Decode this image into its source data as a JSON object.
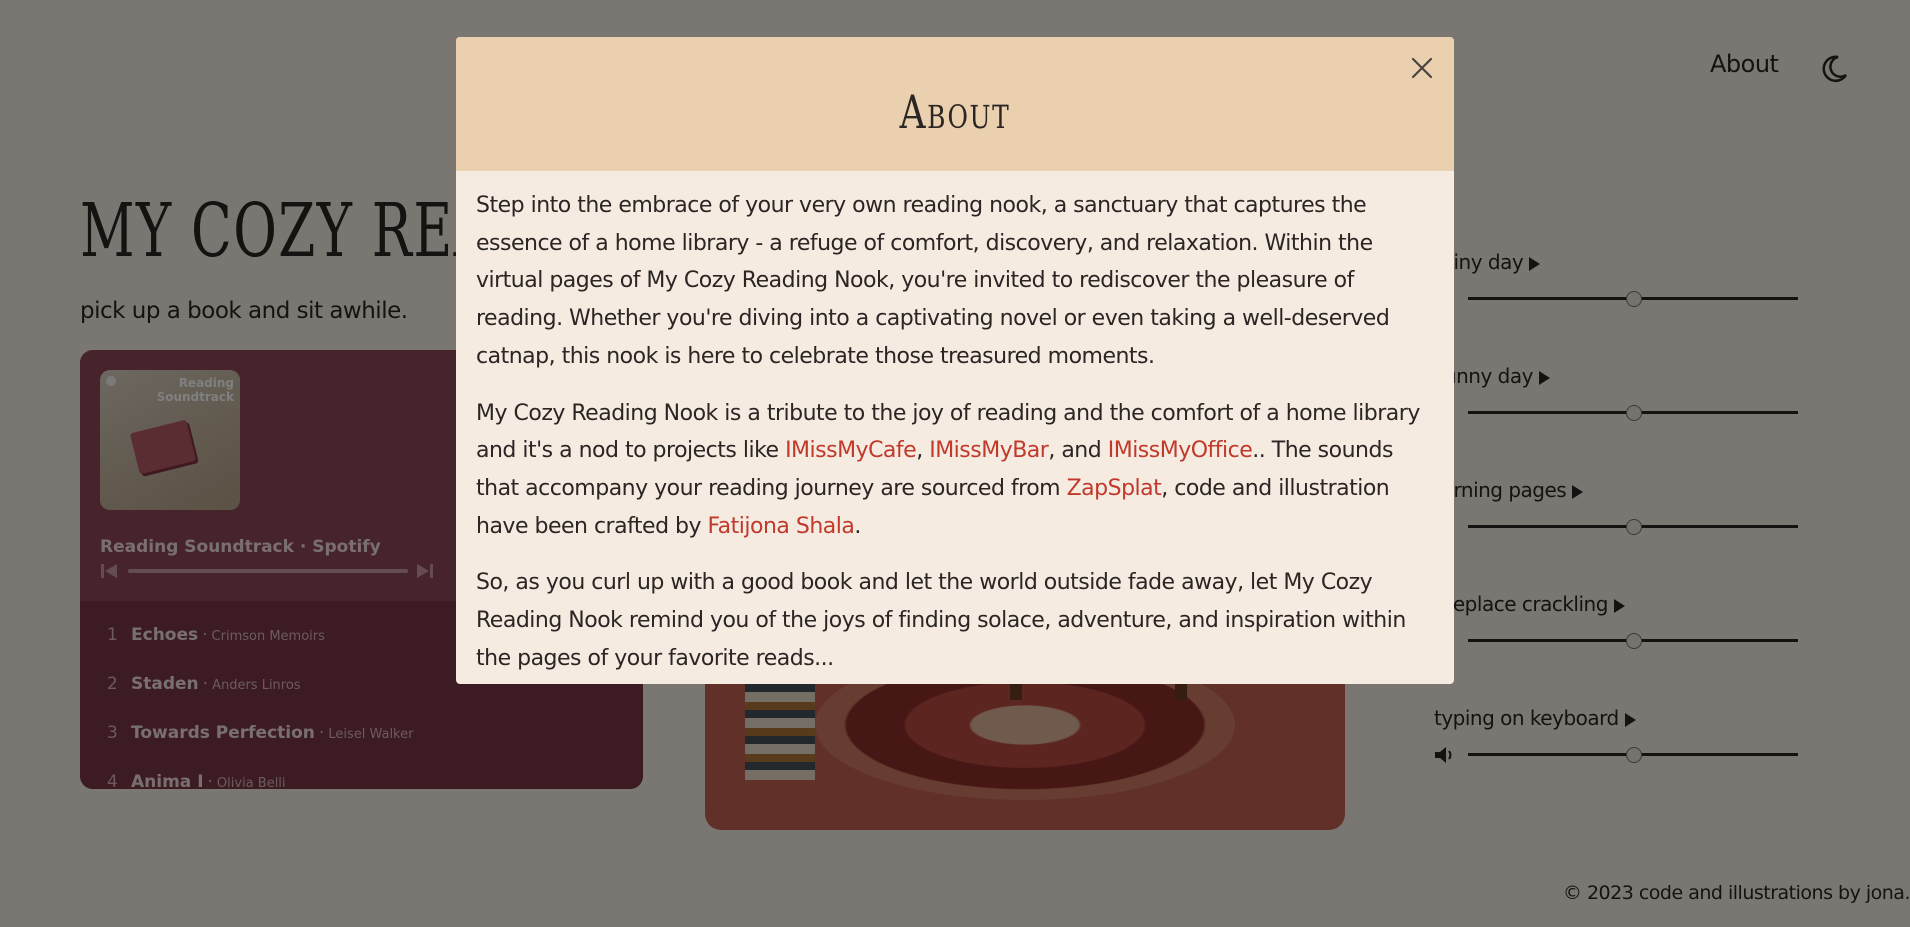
{
  "nav": {
    "about_label": "About",
    "theme_icon": "moon-icon"
  },
  "hero": {
    "title": "MY COZY READING NOOK",
    "subtitle": "pick up a book and sit awhile."
  },
  "player": {
    "cover_label": "Reading Soundtrack",
    "name": "Reading Soundtrack · Spotify",
    "tracks": [
      {
        "num": "1",
        "title": "Echoes",
        "artist": "Crimson Memoirs"
      },
      {
        "num": "2",
        "title": "Staden",
        "artist": "Anders Linros"
      },
      {
        "num": "3",
        "title": "Towards Perfection",
        "artist": "Leisel Walker"
      },
      {
        "num": "4",
        "title": "Anima I",
        "artist": "Olivia Belli"
      }
    ]
  },
  "sounds": [
    {
      "label": "rainy day",
      "volume": 0.5
    },
    {
      "label": "sunny day",
      "volume": 0.5
    },
    {
      "label": "turning pages",
      "volume": 0.5
    },
    {
      "label": "fireplace crackling",
      "volume": 0.5
    },
    {
      "label": "typing on keyboard",
      "volume": 0.5
    }
  ],
  "footer": {
    "text": "© 2023 code and illustrations by jona."
  },
  "modal": {
    "title": "About",
    "p1": "Step into the embrace of your very own reading nook, a sanctuary that captures the essence of a home library - a refuge of comfort, discovery, and relaxation. Within the virtual pages of My Cozy Reading Nook, you're invited to rediscover the pleasure of reading. Whether you're diving into a captivating novel or even taking a well-deserved catnap, this nook is here to celebrate those treasured moments.",
    "p2_a": "My Cozy Reading Nook is a tribute to the joy of reading and the comfort of a home library and it's a nod to projects like ",
    "link_cafe": "IMissMyCafe",
    "p2_b": ", ",
    "link_bar": "IMissMyBar",
    "p2_c": ", and ",
    "link_office": "IMissMyOffice",
    "p2_d": ".. The sounds that accompany your reading journey are sourced from ",
    "link_zapsplat": "ZapSplat",
    "p2_e": ", code and illustration have been crafted by ",
    "link_author": "Fatijona Shala",
    "p2_f": ".",
    "p3": "So, as you curl up with a good book and let the world outside fade away, let My Cozy Reading Nook remind you of the joys of finding solace, adventure, and inspiration within the pages of your favorite reads..."
  },
  "colors": {
    "accent_link": "#c0392b",
    "modal_header": "#ebd0b0",
    "modal_body": "#f5ebe1",
    "player": "#8f4859"
  }
}
